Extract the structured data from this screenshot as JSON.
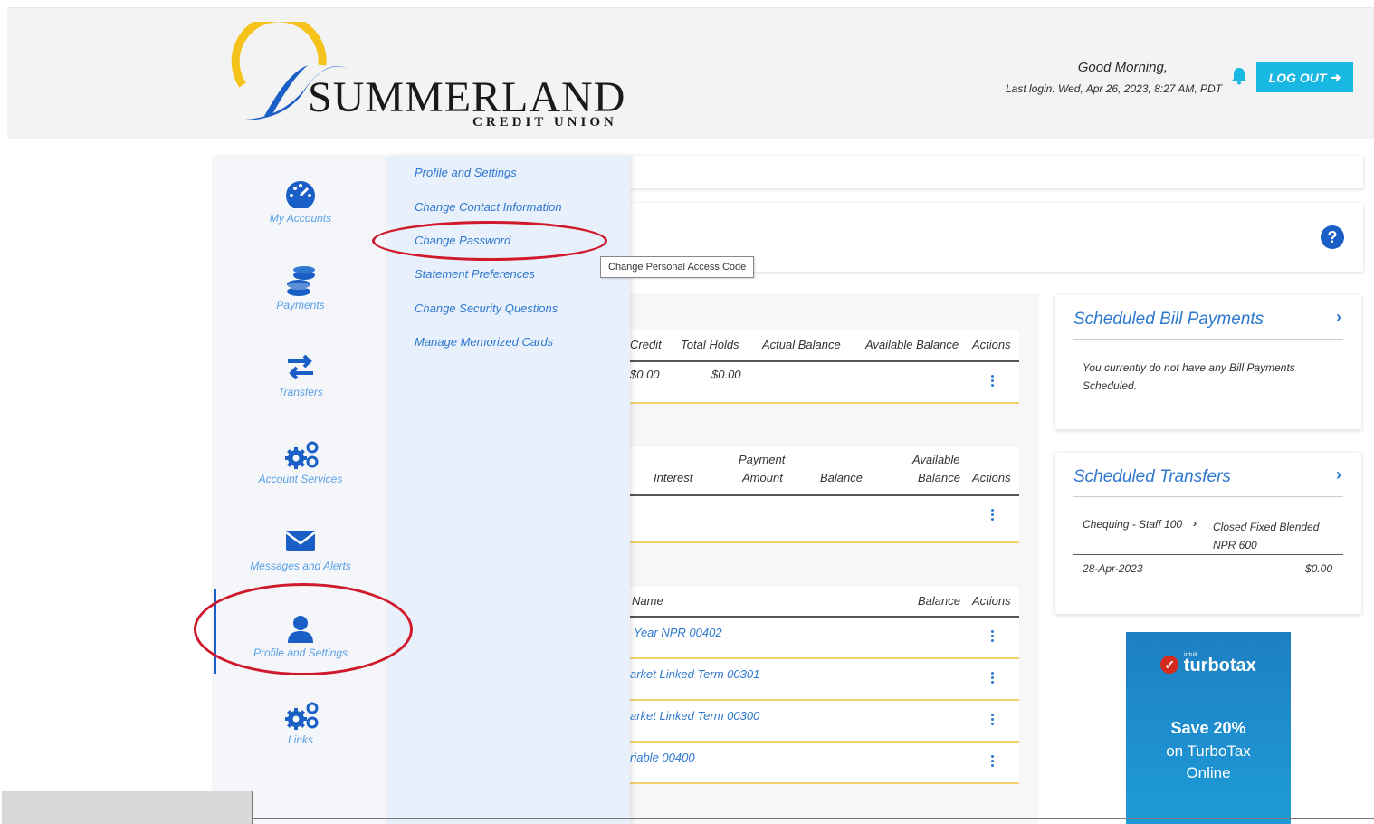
{
  "header": {
    "brand_name": "SUMMERLAND",
    "brand_sub": "CREDIT UNION",
    "greeting": "Good Morning,",
    "last_login": "Last login: Wed, Apr 26, 2023, 8:27 AM, PDT",
    "logout_label": "LOG OUT"
  },
  "leftnav": {
    "items": [
      {
        "label": "My Accounts",
        "icon": "speedometer-icon"
      },
      {
        "label": "Payments",
        "icon": "coins-icon"
      },
      {
        "label": "Transfers",
        "icon": "arrows-exchange-icon"
      },
      {
        "label": "Account Services",
        "icon": "gears-icon"
      },
      {
        "label": "Messages and Alerts",
        "icon": "envelope-icon"
      },
      {
        "label": "Profile and Settings",
        "icon": "user-icon"
      },
      {
        "label": "Links",
        "icon": "gears-icon"
      }
    ],
    "active": "Profile and Settings"
  },
  "submenu": {
    "items": [
      "Profile and Settings",
      "Change Contact Information",
      "Change Password",
      "Statement Preferences",
      "Change Security Questions",
      "Manage Memorized Cards"
    ],
    "tooltip": "Change Personal Access Code"
  },
  "table1": {
    "headers": [
      "Credit",
      "Total Holds",
      "Actual Balance",
      "Available Balance",
      "Actions"
    ],
    "row": {
      "credit": "$0.00",
      "holds": "$0.00"
    }
  },
  "table2": {
    "headers": {
      "interest": "Interest",
      "payment_1": "Payment",
      "payment_2": "Amount",
      "balance": "Balance",
      "available_1": "Available",
      "available_2": "Balance",
      "actions": "Actions"
    }
  },
  "table3": {
    "headers": {
      "name": "Name",
      "balance": "Balance",
      "actions": "Actions"
    },
    "rows": [
      "Year NPR 00402",
      "arket Linked Term 00301",
      "arket Linked Term 00300",
      "riable 00400"
    ]
  },
  "bill_payments": {
    "title": "Scheduled Bill Payments",
    "message": "You currently do not have any Bill Payments Scheduled."
  },
  "transfers": {
    "title": "Scheduled Transfers",
    "from": "Chequing - Staff 100",
    "to": "Closed Fixed Blended NPR 600",
    "date": "28-Apr-2023",
    "amount": "$0.00"
  },
  "ad": {
    "intuit": "intuit",
    "brand": "turbotax",
    "line1": "Save 20%",
    "line2": "on TurboTax",
    "line3": "Online"
  },
  "colors": {
    "accent_blue": "#2f78cf",
    "logout_cyan": "#19b8e3",
    "highlight_red": "#d01a2c",
    "row_divider_gold": "#f3d26b"
  }
}
